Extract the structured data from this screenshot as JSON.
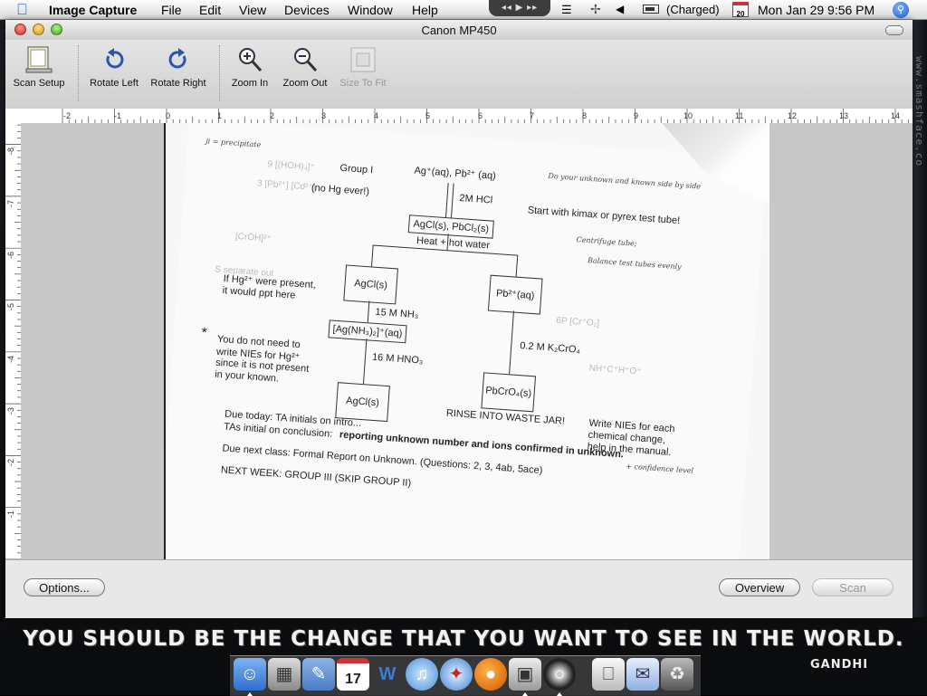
{
  "menubar": {
    "app_name": "Image Capture",
    "menus": [
      "File",
      "Edit",
      "View",
      "Devices",
      "Window",
      "Help"
    ],
    "battery_status": "(Charged)",
    "calendar_day": "20",
    "clock": "Mon Jan 29  9:56 PM",
    "media_controls": "◂◂ ▶ ▸▸"
  },
  "window": {
    "title": "Canon MP450"
  },
  "toolbar": {
    "items": [
      {
        "label": "Scan Setup",
        "icon": "scan-setup-icon",
        "enabled": true
      },
      {
        "label": "Rotate Left",
        "icon": "rotate-left-icon",
        "enabled": true
      },
      {
        "label": "Rotate Right",
        "icon": "rotate-right-icon",
        "enabled": true
      },
      {
        "label": "Zoom In",
        "icon": "zoom-in-icon",
        "enabled": true
      },
      {
        "label": "Zoom Out",
        "icon": "zoom-out-icon",
        "enabled": true
      },
      {
        "label": "Size To Fit",
        "icon": "size-to-fit-icon",
        "enabled": false
      }
    ]
  },
  "ruler": {
    "horizontal": [
      "-2",
      "-1",
      "0",
      "1",
      "2",
      "3",
      "4",
      "5",
      "6",
      "7",
      "8",
      "9",
      "10",
      "11",
      "12",
      "13",
      "14"
    ],
    "vertical": [
      "-8",
      "-7",
      "-6",
      "-5",
      "-4",
      "-3",
      "-2",
      "-1"
    ]
  },
  "scan": {
    "corner_note": "ji = precipitate",
    "group": "Group I",
    "no_hg": "(no  Hg ever!)",
    "ions": "Ag⁺(aq), Pb²⁺ (aq)",
    "hand_note_top": "Do your unknown and known side by side",
    "start_note": "Start with kimax or pyrex test tube!",
    "reagent1": "2M HCl",
    "ppt1": "AgCl(s), PbCl₂(s)",
    "hand_centrifuge": "Centrifuge tube;",
    "hand_balance": "Balance test tubes evenly",
    "heat": "Heat + hot water",
    "box_agcl": "AgCl(s)",
    "box_pb": "Pb²⁺(aq)",
    "hg_note_1": "If Hg²⁺ were present,",
    "hg_note_2": "it would ppt here",
    "reagent_nh3": "15 M NH₃",
    "box_ag_complex": "[Ag(NH₃)₂]⁺(aq)",
    "reagent_k2cro4": "0.2 M K₂CrO₄",
    "nie_note_1": "You do not need to",
    "nie_note_2": "write NIEs for Hg²⁺",
    "nie_note_3": "since it is not present",
    "nie_note_4": "in your known.",
    "reagent_hno3": "16 M HNO₃",
    "box_pbcro4": "PbCrO₄(s)",
    "box_agcl2": "AgCl(s)",
    "rinse": "RINSE INTO WASTE JAR!",
    "write_nie_1": "Write NIEs for each",
    "write_nie_2": "chemical change,",
    "write_nie_3": "help in the manual.",
    "due_today": "Due today: TA initials on intro...",
    "ta_initial": "TAs initial on conclusion:",
    "reporting": "reporting unknown number and ions confirmed in unknown.",
    "hand_confidence": "+ confidence level",
    "due_next": "Due next class: Formal Report on Unknown.  (Questions: 2, 3, 4ab, 5ace)",
    "next_week": "NEXT WEEK:  GROUP III   (SKIP GROUP II)",
    "asterisk": "*"
  },
  "bottom": {
    "options_label": "Options...",
    "overview_label": "Overview",
    "scan_label": "Scan"
  },
  "desktop": {
    "quote": "YOU SHOULD BE THE CHANGE THAT YOU WANT TO SEE IN THE WORLD.",
    "author": "GANDHI",
    "watermark": "www.smashface.co"
  },
  "dock": {
    "items": [
      "finder-icon",
      "calculator-icon",
      "preview-icon",
      "ical-icon",
      "word-icon",
      "itunes-icon",
      "safari-icon",
      "firefox-icon",
      "image-capture-icon",
      "dvd-player-icon",
      "macmini-icon",
      "mail-icon",
      "trash-icon"
    ]
  },
  "colors": {
    "accent": "#2463c4",
    "window_bg": "#e8e8e8",
    "preview_bg": "#c8c8c8"
  }
}
